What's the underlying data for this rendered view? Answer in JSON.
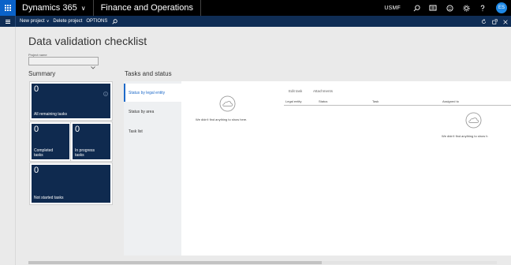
{
  "topbar": {
    "app_name": "Dynamics 365",
    "module_name": "Finance and Operations",
    "company": "USMF",
    "user_initials": "ES"
  },
  "actionbar": {
    "new_project": "New project",
    "delete_project": "Delete project",
    "options": "OPTIONS"
  },
  "page": {
    "title": "Data validation checklist",
    "project_label": "Project name",
    "project_value": ""
  },
  "summary": {
    "heading": "Summary",
    "tiles": [
      {
        "count": "0",
        "label": "All remaining tasks"
      },
      {
        "count": "0",
        "label_line1": "Completed",
        "label_line2": "tasks"
      },
      {
        "count": "0",
        "label_line1": "In progress",
        "label_line2": "tasks"
      },
      {
        "count": "0",
        "label": "Not started tasks"
      }
    ]
  },
  "tasks": {
    "heading": "Tasks and status",
    "tabs": [
      {
        "label": "Status by legal entity",
        "selected": true
      },
      {
        "label": "Status by area",
        "selected": false
      },
      {
        "label": "Task list",
        "selected": false
      }
    ],
    "empty_text": "We didn't find anything to show here.",
    "sub_actions": [
      "Edit task",
      "Attachments"
    ],
    "columns": [
      "Legal entity",
      "Status",
      "Task",
      "Assigned to"
    ],
    "grid_empty_text": "We didn't find anything to show h"
  },
  "colors": {
    "topbar": "#000000",
    "waffle": "#0a62c9",
    "actionbar": "#0f2d55",
    "tile": "#0f2a4f",
    "accent": "#1e6ac9"
  }
}
